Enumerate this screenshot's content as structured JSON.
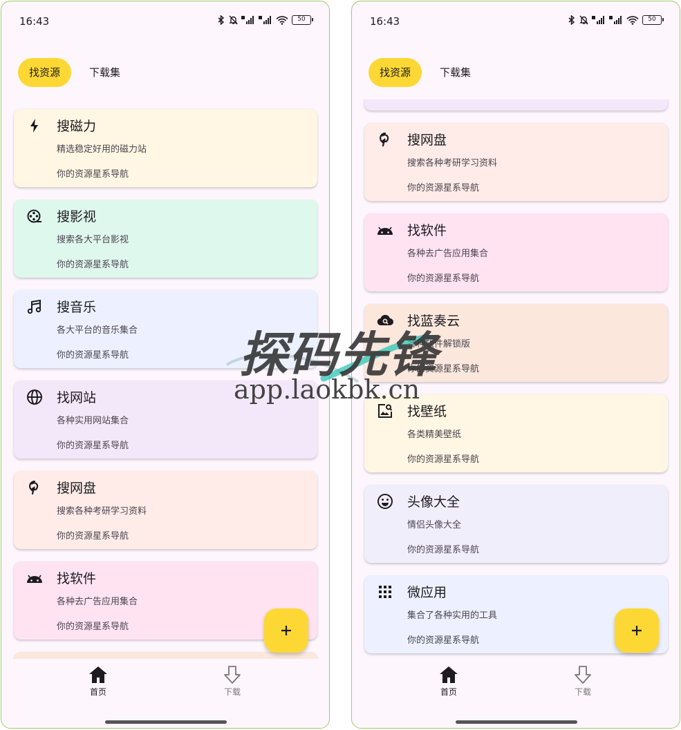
{
  "status": {
    "time": "16:43",
    "battery": "50"
  },
  "tabs": {
    "find": "找资源",
    "collection": "下载集"
  },
  "cards": [
    {
      "title": "搜磁力",
      "desc": "精选稳定好用的磁力站",
      "foot": "你的资源星系导航",
      "icon": "bolt-icon",
      "color": "#fff6e3"
    },
    {
      "title": "搜影视",
      "desc": "搜索各大平台影视",
      "foot": "你的资源星系导航",
      "icon": "film-reel-icon",
      "color": "#dff8ee"
    },
    {
      "title": "搜音乐",
      "desc": "各大平台的音乐集合",
      "foot": "你的资源星系导航",
      "icon": "music-note-icon",
      "color": "#edf1ff"
    },
    {
      "title": "找网站",
      "desc": "各种实用网站集合",
      "foot": "你的资源星系导航",
      "icon": "globe-icon",
      "color": "#f3e8f9"
    },
    {
      "title": "搜网盘",
      "desc": "搜索各种考研学习资料",
      "foot": "你的资源星系导航",
      "icon": "pinterest-icon",
      "color": "#ffece8"
    },
    {
      "title": "找软件",
      "desc": "各种去广告应用集合",
      "foot": "你的资源星系导航",
      "icon": "android-icon",
      "color": "#ffe3f1"
    },
    {
      "title": "找蓝奏云",
      "desc": "各种软件解锁版",
      "foot": "你的资源星系导航",
      "icon": "cloud-search-icon",
      "color": "#fbe7dc"
    },
    {
      "title": "找壁纸",
      "desc": "各类精美壁纸",
      "foot": "你的资源星系导航",
      "icon": "image-search-icon",
      "color": "#fff6e3"
    },
    {
      "title": "头像大全",
      "desc": "情侣头像大全",
      "foot": "你的资源星系导航",
      "icon": "smiley-icon",
      "color": "#f1eefc"
    },
    {
      "title": "微应用",
      "desc": "集合了各种实用的工具",
      "foot": "你的资源星系导航",
      "icon": "apps-grid-icon",
      "color": "#edf1ff"
    }
  ],
  "nav": {
    "home": "首页",
    "download": "下载"
  },
  "fab": {
    "label": "+"
  },
  "watermark": {
    "title": "探码先锋",
    "url": "app.laokbk.cn"
  },
  "colors": {
    "accent": "#fdd835",
    "background": "#fdf6fd",
    "frame": "#9ccc65"
  }
}
